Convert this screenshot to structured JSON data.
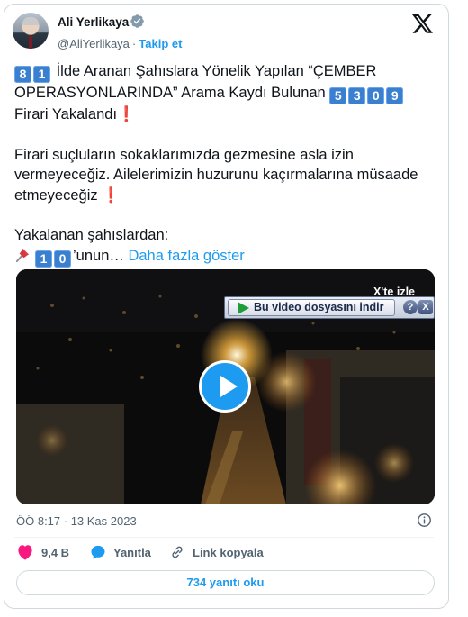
{
  "author": {
    "name": "Ali Yerlikaya",
    "handle": "@AliYerlikaya",
    "follow_label": "Takip et",
    "separator": "·"
  },
  "tweet": {
    "line1": {
      "keycaps": [
        "8",
        "1"
      ],
      "text_a": "İlde Aranan Şahıslara Yönelik Yapılan “ÇEMBER OPERASYONLARINDA” Arama Kaydı Bulunan",
      "count_keycaps": [
        "5",
        "3",
        "0",
        "9"
      ],
      "text_b": "Firari Yakalandı",
      "mark": "❗"
    },
    "paragraph2": "Firari suçluların sokaklarımızda gezmesine asla izin vermeyeceğiz. Ailelerimizin huzurunu kaçırmalarına müsaade etmeyeceğiz",
    "paragraph2_mark": "❗",
    "paragraph3_intro": "Yakalanan şahıslardan:",
    "pin_keycaps": [
      "1",
      "0"
    ],
    "pin_text": "’unun…",
    "show_more": "Daha fazla göster"
  },
  "video": {
    "watch_on_x": "X'te izle",
    "download_label": "Bu video dosyasını indir",
    "help_label": "?",
    "close_label": "X"
  },
  "meta": {
    "timestamp": "ÖÖ 8:17 · 13 Kas 2023"
  },
  "actions": {
    "like_count": "9,4 B",
    "reply_label": "Yanıtla",
    "copy_link_label": "Link kopyala"
  },
  "read_replies": "734 yanıtı oku",
  "colors": {
    "accent": "#1d9bf0",
    "like": "#f91880",
    "keycap": "#3a7fd0",
    "text": "#0f1419",
    "muted": "#536471"
  }
}
